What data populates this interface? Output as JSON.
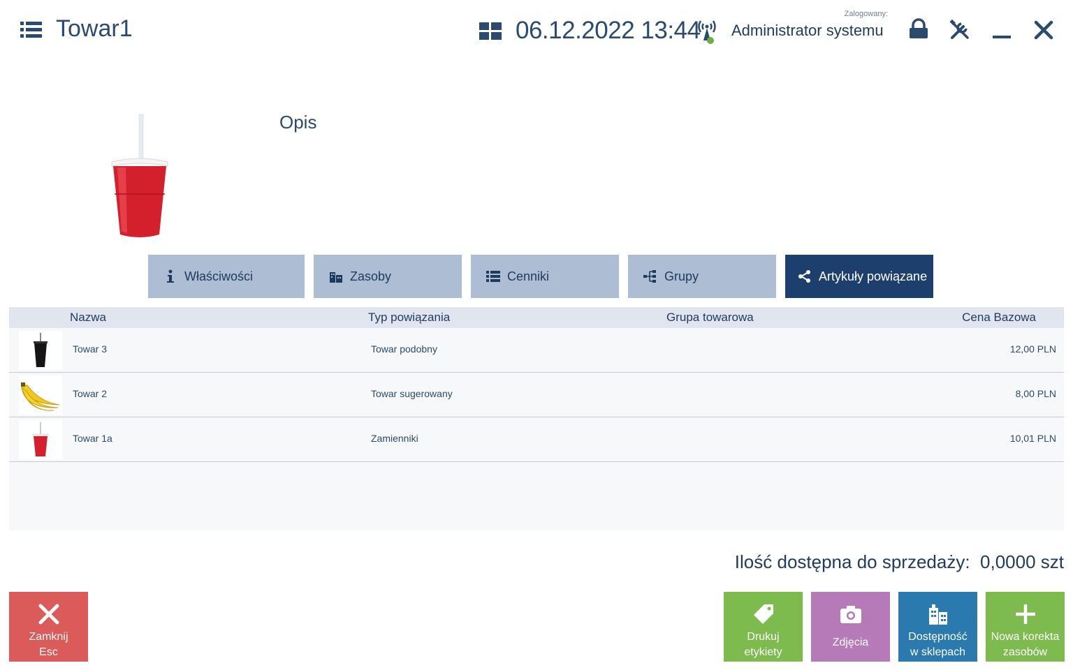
{
  "header": {
    "title": "Towar1",
    "datetime": "06.12.2022 13:44",
    "logged_label": "Zalogowany:",
    "user": "Administrator systemu"
  },
  "product": {
    "description_label": "Opis"
  },
  "tabs": [
    {
      "label": "Właściwości",
      "icon": "info-icon",
      "active": false
    },
    {
      "label": "Zasoby",
      "icon": "buildings-icon",
      "active": false
    },
    {
      "label": "Cenniki",
      "icon": "list-icon",
      "active": false
    },
    {
      "label": "Grupy",
      "icon": "tree-icon",
      "active": false
    },
    {
      "label": "Artykuły powiązane",
      "icon": "share-icon",
      "active": true
    }
  ],
  "table": {
    "columns": [
      "Nazwa",
      "Typ powiązania",
      "Grupa towarowa",
      "Cena Bazowa"
    ],
    "rows": [
      {
        "name": "Towar 3",
        "type": "Towar podobny",
        "group": "",
        "price": "12,00 PLN",
        "image": "black-cup"
      },
      {
        "name": "Towar 2",
        "type": "Towar sugerowany",
        "group": "",
        "price": "8,00 PLN",
        "image": "bananas"
      },
      {
        "name": "Towar 1a",
        "type": "Zamienniki",
        "group": "",
        "price": "10,01 PLN",
        "image": "red-cup"
      }
    ]
  },
  "available": {
    "label": "Ilość dostępna do sprzedaży:",
    "value": "0,0000 szt"
  },
  "buttons": {
    "close": {
      "line1": "Zamknij",
      "line2": "Esc"
    },
    "print": {
      "line1": "Drukuj",
      "line2": "etykiety"
    },
    "photos": {
      "line1": "Zdjęcia"
    },
    "availability": {
      "line1": "Dostępność",
      "line2": "w sklepach"
    },
    "correction": {
      "line1": "Nowa korekta",
      "line2": "zasobów"
    }
  },
  "colors": {
    "active_tab": "#1d3f6e",
    "inactive_tab": "#adbdd3",
    "close_button": "#db5a5a",
    "green_button": "#7dbb4f",
    "purple_button": "#b67ab8",
    "blue_button": "#2a7ab0"
  }
}
